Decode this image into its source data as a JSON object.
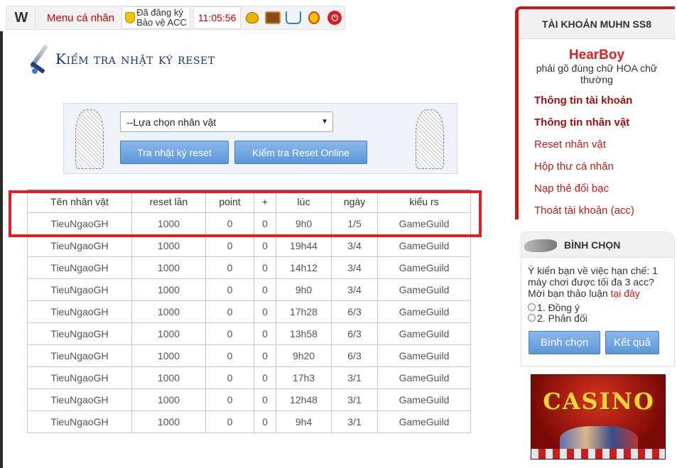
{
  "topbar": {
    "logo": "W",
    "menu_label": "Menu cá nhân",
    "acc_line1": "Đã đăng ký",
    "acc_line2": "Bảo vệ ACC",
    "clock": "11:05:56",
    "icons": [
      "money-bag-icon",
      "treasure-chest-icon",
      "shopping-cart-icon",
      "medal-icon",
      "power-icon"
    ]
  },
  "main": {
    "title": "Kiểm tra nhật ký reset",
    "select_value": "--Lựa chọn nhân vật",
    "btn_tra": "Tra nhật ký reset",
    "btn_online": "Kiểm tra Reset Online",
    "table": {
      "headers": [
        "Tên nhân vật",
        "reset lần",
        "point",
        "+",
        "lúc",
        "ngày",
        "kiểu rs"
      ],
      "rows": [
        [
          "TieuNgaoGH",
          "1000",
          "0",
          "0",
          "9h0",
          "1/5",
          "GameGuild"
        ],
        [
          "TieuNgaoGH",
          "1000",
          "0",
          "0",
          "19h44",
          "3/4",
          "GameGuild"
        ],
        [
          "TieuNgaoGH",
          "1000",
          "0",
          "0",
          "14h12",
          "3/4",
          "GameGuild"
        ],
        [
          "TieuNgaoGH",
          "1000",
          "0",
          "0",
          "9h0",
          "3/4",
          "GameGuild"
        ],
        [
          "TieuNgaoGH",
          "1000",
          "0",
          "0",
          "17h28",
          "6/3",
          "GameGuild"
        ],
        [
          "TieuNgaoGH",
          "1000",
          "0",
          "0",
          "13h58",
          "6/3",
          "GameGuild"
        ],
        [
          "TieuNgaoGH",
          "1000",
          "0",
          "0",
          "9h20",
          "6/3",
          "GameGuild"
        ],
        [
          "TieuNgaoGH",
          "1000",
          "0",
          "0",
          "17h3",
          "3/1",
          "GameGuild"
        ],
        [
          "TieuNgaoGH",
          "1000",
          "0",
          "0",
          "12h48",
          "3/1",
          "GameGuild"
        ],
        [
          "TieuNgaoGH",
          "1000",
          "0",
          "0",
          "9h4",
          "3/1",
          "GameGuild"
        ]
      ]
    }
  },
  "sidebar": {
    "account_title": "TÀI KHOẢN MUHN SS8",
    "username": "HearBoy",
    "note": "phải gõ đúng chữ HOA chữ thường",
    "links": [
      "Thông tin tài khoản",
      "Thông tin nhân vật",
      "Reset nhân vật",
      "Hộp thư cá nhân",
      "Nạp thẻ đổi bạc",
      "Thoát tài khoản (acc)"
    ],
    "vote_title": "BÌNH CHỌN",
    "vote_question": "Ý kiến bạn về việc hạn chế: 1 máy chơi được tối đa 3 acc? Mời bạn thảo luận",
    "vote_link": "tại đây",
    "vote_options": [
      "1. Đồng ý",
      "2. Phản đối"
    ],
    "btn_binhchon": "Bình chọn",
    "btn_ketqua": "Kết quả",
    "banner_text": "CASINO"
  }
}
